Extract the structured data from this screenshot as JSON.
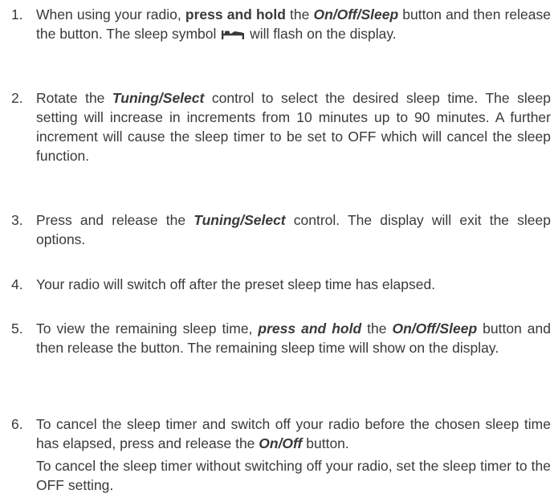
{
  "steps": [
    {
      "number": "1.",
      "parts": {
        "a": "When using your radio, ",
        "b": "press and hold",
        "c": " the ",
        "d": "On/Off/Sleep",
        "e": " button and then release the button. The sleep symbol ",
        "f": " will flash on the display."
      },
      "icon": "sleep-symbol-icon"
    },
    {
      "number": "2.",
      "parts": {
        "a": "Rotate the ",
        "b": "Tuning/Select",
        "c": " control to select the desired sleep time. The sleep setting will increase in increments from 10 minutes up to 90 minutes. A further increment will cause the sleep timer to be set to OFF which will cancel the sleep function."
      }
    },
    {
      "number": "3.",
      "parts": {
        "a": "Press and release the ",
        "b": "Tuning/Select",
        "c": " control. The display will exit the sleep options."
      }
    },
    {
      "number": "4.",
      "parts": {
        "a": "Your radio will switch off after the preset sleep time has elapsed."
      }
    },
    {
      "number": "5.",
      "parts": {
        "a": "To view the remaining sleep time, ",
        "b": "press and hold",
        "c": " the ",
        "d": "On/Off/Sleep",
        "e": " button and then release the button. The remaining sleep time will show on the display."
      }
    },
    {
      "number": "6.",
      "parts": {
        "a": "To cancel the sleep timer and switch off your radio before the chosen sleep time has elapsed, press and release the ",
        "b": "On/Off",
        "c": " button."
      },
      "extra": "To cancel the sleep timer without switching off your radio, set the sleep timer to the OFF setting."
    }
  ],
  "colors": {
    "text": "#3a3a3a",
    "background": "#ffffff"
  }
}
